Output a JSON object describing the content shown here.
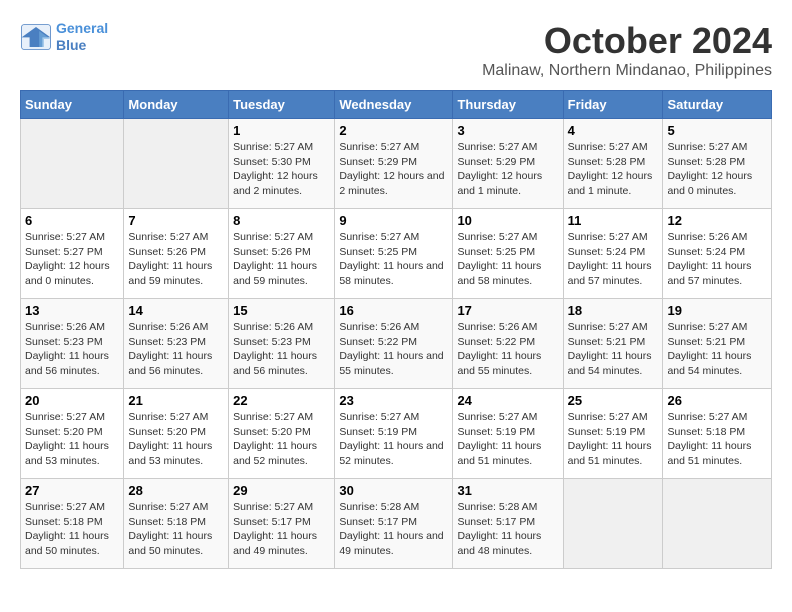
{
  "header": {
    "logo_line1": "General",
    "logo_line2": "Blue",
    "month": "October 2024",
    "location": "Malinaw, Northern Mindanao, Philippines"
  },
  "calendar": {
    "weekdays": [
      "Sunday",
      "Monday",
      "Tuesday",
      "Wednesday",
      "Thursday",
      "Friday",
      "Saturday"
    ],
    "weeks": [
      [
        {
          "day": "",
          "sunrise": "",
          "sunset": "",
          "daylight": ""
        },
        {
          "day": "",
          "sunrise": "",
          "sunset": "",
          "daylight": ""
        },
        {
          "day": "1",
          "sunrise": "Sunrise: 5:27 AM",
          "sunset": "Sunset: 5:30 PM",
          "daylight": "Daylight: 12 hours and 2 minutes."
        },
        {
          "day": "2",
          "sunrise": "Sunrise: 5:27 AM",
          "sunset": "Sunset: 5:29 PM",
          "daylight": "Daylight: 12 hours and 2 minutes."
        },
        {
          "day": "3",
          "sunrise": "Sunrise: 5:27 AM",
          "sunset": "Sunset: 5:29 PM",
          "daylight": "Daylight: 12 hours and 1 minute."
        },
        {
          "day": "4",
          "sunrise": "Sunrise: 5:27 AM",
          "sunset": "Sunset: 5:28 PM",
          "daylight": "Daylight: 12 hours and 1 minute."
        },
        {
          "day": "5",
          "sunrise": "Sunrise: 5:27 AM",
          "sunset": "Sunset: 5:28 PM",
          "daylight": "Daylight: 12 hours and 0 minutes."
        }
      ],
      [
        {
          "day": "6",
          "sunrise": "Sunrise: 5:27 AM",
          "sunset": "Sunset: 5:27 PM",
          "daylight": "Daylight: 12 hours and 0 minutes."
        },
        {
          "day": "7",
          "sunrise": "Sunrise: 5:27 AM",
          "sunset": "Sunset: 5:26 PM",
          "daylight": "Daylight: 11 hours and 59 minutes."
        },
        {
          "day": "8",
          "sunrise": "Sunrise: 5:27 AM",
          "sunset": "Sunset: 5:26 PM",
          "daylight": "Daylight: 11 hours and 59 minutes."
        },
        {
          "day": "9",
          "sunrise": "Sunrise: 5:27 AM",
          "sunset": "Sunset: 5:25 PM",
          "daylight": "Daylight: 11 hours and 58 minutes."
        },
        {
          "day": "10",
          "sunrise": "Sunrise: 5:27 AM",
          "sunset": "Sunset: 5:25 PM",
          "daylight": "Daylight: 11 hours and 58 minutes."
        },
        {
          "day": "11",
          "sunrise": "Sunrise: 5:27 AM",
          "sunset": "Sunset: 5:24 PM",
          "daylight": "Daylight: 11 hours and 57 minutes."
        },
        {
          "day": "12",
          "sunrise": "Sunrise: 5:26 AM",
          "sunset": "Sunset: 5:24 PM",
          "daylight": "Daylight: 11 hours and 57 minutes."
        }
      ],
      [
        {
          "day": "13",
          "sunrise": "Sunrise: 5:26 AM",
          "sunset": "Sunset: 5:23 PM",
          "daylight": "Daylight: 11 hours and 56 minutes."
        },
        {
          "day": "14",
          "sunrise": "Sunrise: 5:26 AM",
          "sunset": "Sunset: 5:23 PM",
          "daylight": "Daylight: 11 hours and 56 minutes."
        },
        {
          "day": "15",
          "sunrise": "Sunrise: 5:26 AM",
          "sunset": "Sunset: 5:23 PM",
          "daylight": "Daylight: 11 hours and 56 minutes."
        },
        {
          "day": "16",
          "sunrise": "Sunrise: 5:26 AM",
          "sunset": "Sunset: 5:22 PM",
          "daylight": "Daylight: 11 hours and 55 minutes."
        },
        {
          "day": "17",
          "sunrise": "Sunrise: 5:26 AM",
          "sunset": "Sunset: 5:22 PM",
          "daylight": "Daylight: 11 hours and 55 minutes."
        },
        {
          "day": "18",
          "sunrise": "Sunrise: 5:27 AM",
          "sunset": "Sunset: 5:21 PM",
          "daylight": "Daylight: 11 hours and 54 minutes."
        },
        {
          "day": "19",
          "sunrise": "Sunrise: 5:27 AM",
          "sunset": "Sunset: 5:21 PM",
          "daylight": "Daylight: 11 hours and 54 minutes."
        }
      ],
      [
        {
          "day": "20",
          "sunrise": "Sunrise: 5:27 AM",
          "sunset": "Sunset: 5:20 PM",
          "daylight": "Daylight: 11 hours and 53 minutes."
        },
        {
          "day": "21",
          "sunrise": "Sunrise: 5:27 AM",
          "sunset": "Sunset: 5:20 PM",
          "daylight": "Daylight: 11 hours and 53 minutes."
        },
        {
          "day": "22",
          "sunrise": "Sunrise: 5:27 AM",
          "sunset": "Sunset: 5:20 PM",
          "daylight": "Daylight: 11 hours and 52 minutes."
        },
        {
          "day": "23",
          "sunrise": "Sunrise: 5:27 AM",
          "sunset": "Sunset: 5:19 PM",
          "daylight": "Daylight: 11 hours and 52 minutes."
        },
        {
          "day": "24",
          "sunrise": "Sunrise: 5:27 AM",
          "sunset": "Sunset: 5:19 PM",
          "daylight": "Daylight: 11 hours and 51 minutes."
        },
        {
          "day": "25",
          "sunrise": "Sunrise: 5:27 AM",
          "sunset": "Sunset: 5:19 PM",
          "daylight": "Daylight: 11 hours and 51 minutes."
        },
        {
          "day": "26",
          "sunrise": "Sunrise: 5:27 AM",
          "sunset": "Sunset: 5:18 PM",
          "daylight": "Daylight: 11 hours and 51 minutes."
        }
      ],
      [
        {
          "day": "27",
          "sunrise": "Sunrise: 5:27 AM",
          "sunset": "Sunset: 5:18 PM",
          "daylight": "Daylight: 11 hours and 50 minutes."
        },
        {
          "day": "28",
          "sunrise": "Sunrise: 5:27 AM",
          "sunset": "Sunset: 5:18 PM",
          "daylight": "Daylight: 11 hours and 50 minutes."
        },
        {
          "day": "29",
          "sunrise": "Sunrise: 5:27 AM",
          "sunset": "Sunset: 5:17 PM",
          "daylight": "Daylight: 11 hours and 49 minutes."
        },
        {
          "day": "30",
          "sunrise": "Sunrise: 5:28 AM",
          "sunset": "Sunset: 5:17 PM",
          "daylight": "Daylight: 11 hours and 49 minutes."
        },
        {
          "day": "31",
          "sunrise": "Sunrise: 5:28 AM",
          "sunset": "Sunset: 5:17 PM",
          "daylight": "Daylight: 11 hours and 48 minutes."
        },
        {
          "day": "",
          "sunrise": "",
          "sunset": "",
          "daylight": ""
        },
        {
          "day": "",
          "sunrise": "",
          "sunset": "",
          "daylight": ""
        }
      ]
    ]
  }
}
